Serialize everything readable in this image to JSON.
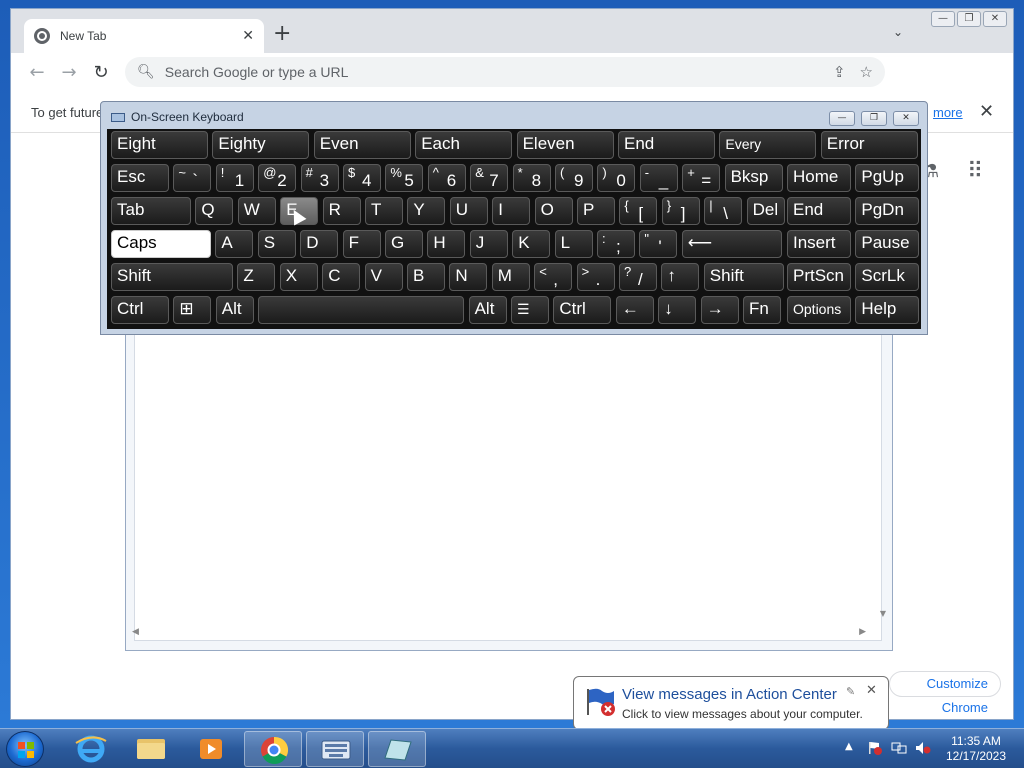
{
  "browser": {
    "tab_title": "New Tab",
    "address_placeholder": "Search Google or type a URL",
    "infobar_text": "To get future",
    "infobar_link": "more",
    "customize_label": "Customize Chrome"
  },
  "osk": {
    "title": "On-Screen Keyboard",
    "rows": [
      [
        "Eight",
        "Eighty",
        "Even",
        "Each",
        "Eleven",
        "End",
        "Every",
        "Error"
      ],
      [
        "Esc",
        "~ `",
        "! 1",
        "@ 2",
        "# 3",
        "$ 4",
        "% 5",
        "^ 6",
        "& 7",
        "* 8",
        "( 9",
        ") 0",
        "- _",
        "+ =",
        "Bksp",
        "Home",
        "PgUp"
      ],
      [
        "Tab",
        "Q",
        "W",
        "E",
        "R",
        "T",
        "Y",
        "U",
        "I",
        "O",
        "P",
        "{ [",
        "} ]",
        "| \\",
        "Del",
        "End",
        "PgDn"
      ],
      [
        "Caps",
        "A",
        "S",
        "D",
        "F",
        "G",
        "H",
        "J",
        "K",
        "L",
        ": ;",
        "\" '",
        "Enter",
        "Insert",
        "Pause"
      ],
      [
        "Shift",
        "Z",
        "X",
        "C",
        "V",
        "B",
        "N",
        "M",
        "< ,",
        "> .",
        "? /",
        "↑",
        "Shift",
        "PrtScn",
        "ScrLk"
      ],
      [
        "Ctrl",
        "Win",
        "Alt",
        "Space",
        "Alt",
        "Menu",
        "Ctrl",
        "←",
        "↓",
        "→",
        "Fn",
        "Options",
        "Help"
      ]
    ],
    "pressed_key": "E",
    "active_key": "Caps"
  },
  "notification": {
    "title": "View messages in Action Center",
    "subtitle": "Click to view messages about your computer."
  },
  "taskbar": {
    "clock_time": "11:35 AM",
    "clock_date": "12/17/2023"
  },
  "colors": {
    "accent": "#1a73e8",
    "key_bg": "#2a2a2a",
    "osk_frame": "#c6d3e4"
  }
}
